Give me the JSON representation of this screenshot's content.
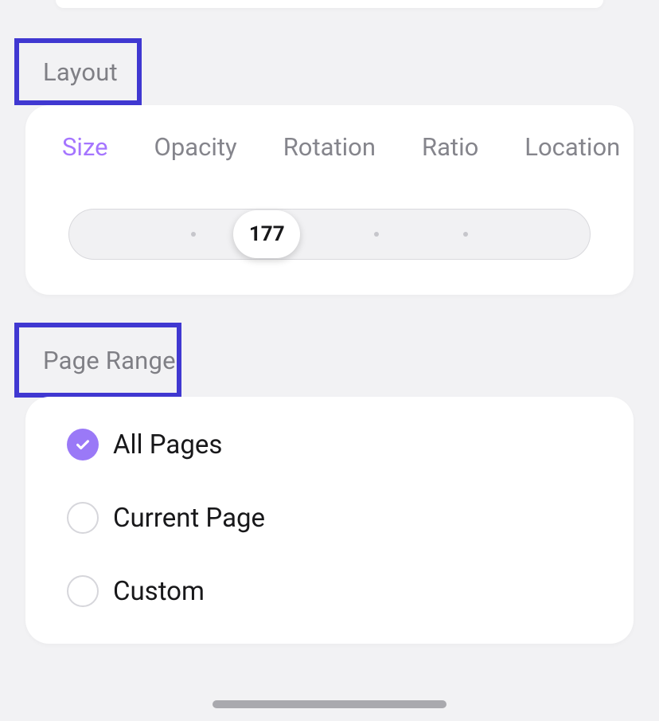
{
  "sections": {
    "layout": {
      "heading": "Layout",
      "tabs": [
        {
          "label": "Size",
          "active": true
        },
        {
          "label": "Opacity",
          "active": false
        },
        {
          "label": "Rotation",
          "active": false
        },
        {
          "label": "Ratio",
          "active": false
        },
        {
          "label": "Location",
          "active": false
        }
      ],
      "slider": {
        "value": "177",
        "thumb_position_pct": 38,
        "ticks_pct": [
          24,
          59,
          76
        ]
      }
    },
    "page_range": {
      "heading": "Page Range",
      "options": [
        {
          "label": "All Pages",
          "selected": true
        },
        {
          "label": "Current Page",
          "selected": false
        },
        {
          "label": "Custom",
          "selected": false
        }
      ]
    }
  },
  "colors": {
    "accent": "#a575ff",
    "radio_checked": "#9a79f7",
    "highlight_border": "#4038d1",
    "label_gray": "#7f7f85",
    "tab_gray": "#85858c"
  }
}
